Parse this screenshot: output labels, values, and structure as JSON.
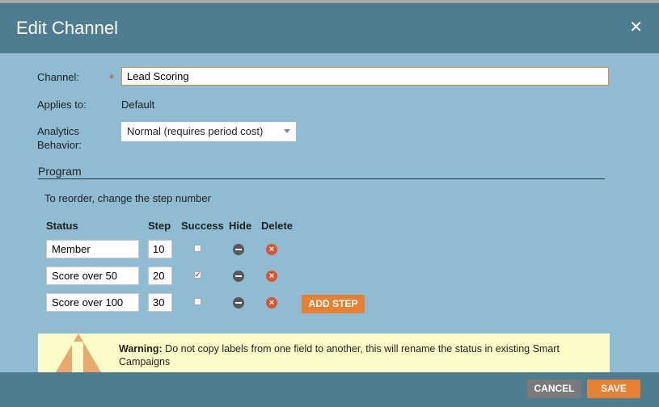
{
  "dialog": {
    "title": "Edit Channel",
    "close_icon": "close-icon"
  },
  "form": {
    "channel_label": "Channel:",
    "channel_value": "Lead Scoring",
    "required_mark": "*",
    "applies_label": "Applies to:",
    "applies_value": "Default",
    "analytics_label_1": "Analytics",
    "analytics_label_2": "Behavior:",
    "analytics_value": "Normal (requires period cost)"
  },
  "program": {
    "section_title": "Program",
    "reorder_hint": "To reorder, change the step number",
    "headers": {
      "status": "Status",
      "step": "Step",
      "success": "Success",
      "hide": "Hide",
      "delete": "Delete"
    },
    "rows": [
      {
        "status": "Member",
        "step": "10",
        "success": false
      },
      {
        "status": "Score over 50",
        "step": "20",
        "success": true
      },
      {
        "status": "Score over 100",
        "step": "30",
        "success": false
      }
    ],
    "add_step_label": "ADD STEP"
  },
  "warning": {
    "bold": "Warning:",
    "text": " Do not copy labels from one field to another, this will rename the status in existing Smart Campaigns"
  },
  "footer": {
    "cancel_label": "CANCEL",
    "save_label": "SAVE"
  },
  "colors": {
    "header": "#4e7c91",
    "body": "#8fbcd2",
    "accent": "#e68032",
    "warning_bg": "#fdfbc7"
  }
}
